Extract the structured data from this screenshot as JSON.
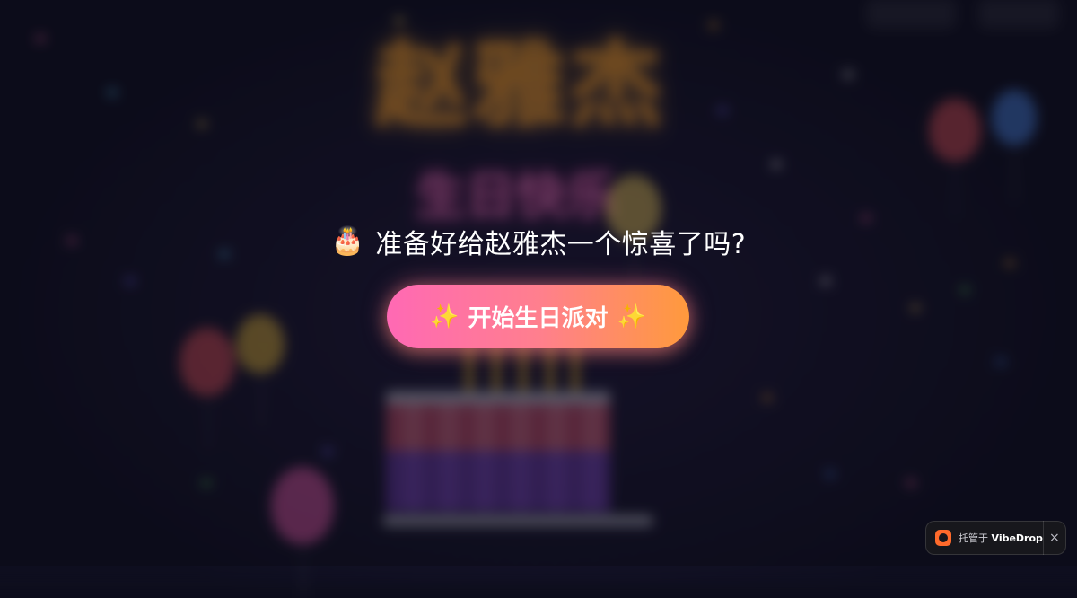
{
  "background": {
    "name_banner": "赵雅杰",
    "subtitle_banner": "生日快乐",
    "colors": {
      "base": "#0e0e1f",
      "name_glow": "#ffb03b",
      "subtitle_glow": "#ff3fa9"
    }
  },
  "prompt": {
    "icon": "birthday-cake-icon",
    "icon_glyph": "🎂",
    "text": "准备好给赵雅杰一个惊喜了吗?"
  },
  "start_button": {
    "sparkle_icon": "✨",
    "label": "开始生日派对",
    "gradient": [
      "#ff69b4",
      "#ff9a3c"
    ]
  },
  "hosted_badge": {
    "prefix": "托管于",
    "brand": "VibeDrop",
    "close_glyph": "×",
    "logo_color": "#ff6a2b"
  }
}
